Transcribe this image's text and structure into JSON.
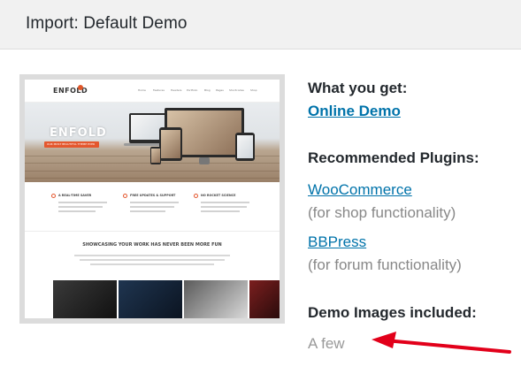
{
  "modal": {
    "title": "Import: Default Demo"
  },
  "preview": {
    "logo": "ENFOLD",
    "menu": [
      "Home",
      "Features",
      "Headers",
      "Portfolio",
      "Blog",
      "Pages",
      "Shortcodes",
      "Shop"
    ],
    "hero_title": "ENFOLD",
    "hero_subtitle": "OUR MOST BEAUTIFUL THEME EVER",
    "features": [
      "A REAL-TIME SAVER",
      "FREE UPDATES & SUPPORT",
      "NO ROCKET SCIENCE"
    ],
    "showcase_title": "SHOWCASING YOUR WORK HAS NEVER BEEN MORE FUN"
  },
  "info": {
    "what_you_get_heading": "What you get:",
    "online_demo_link": "Online Demo",
    "recommended_heading": "Recommended Plugins:",
    "plugins": [
      {
        "name": "WooCommerce",
        "note": "(for shop functionality)"
      },
      {
        "name": "BBPress",
        "note": "(for forum functionality)"
      }
    ],
    "demo_images_heading": "Demo Images included:",
    "demo_images_value": "A few"
  },
  "colors": {
    "link": "#0073aa",
    "arrow": "#e2001a",
    "header_bg": "#f1f1f1",
    "accent": "#e4572e"
  },
  "icons": {
    "annotation": "red-arrow-icon"
  }
}
